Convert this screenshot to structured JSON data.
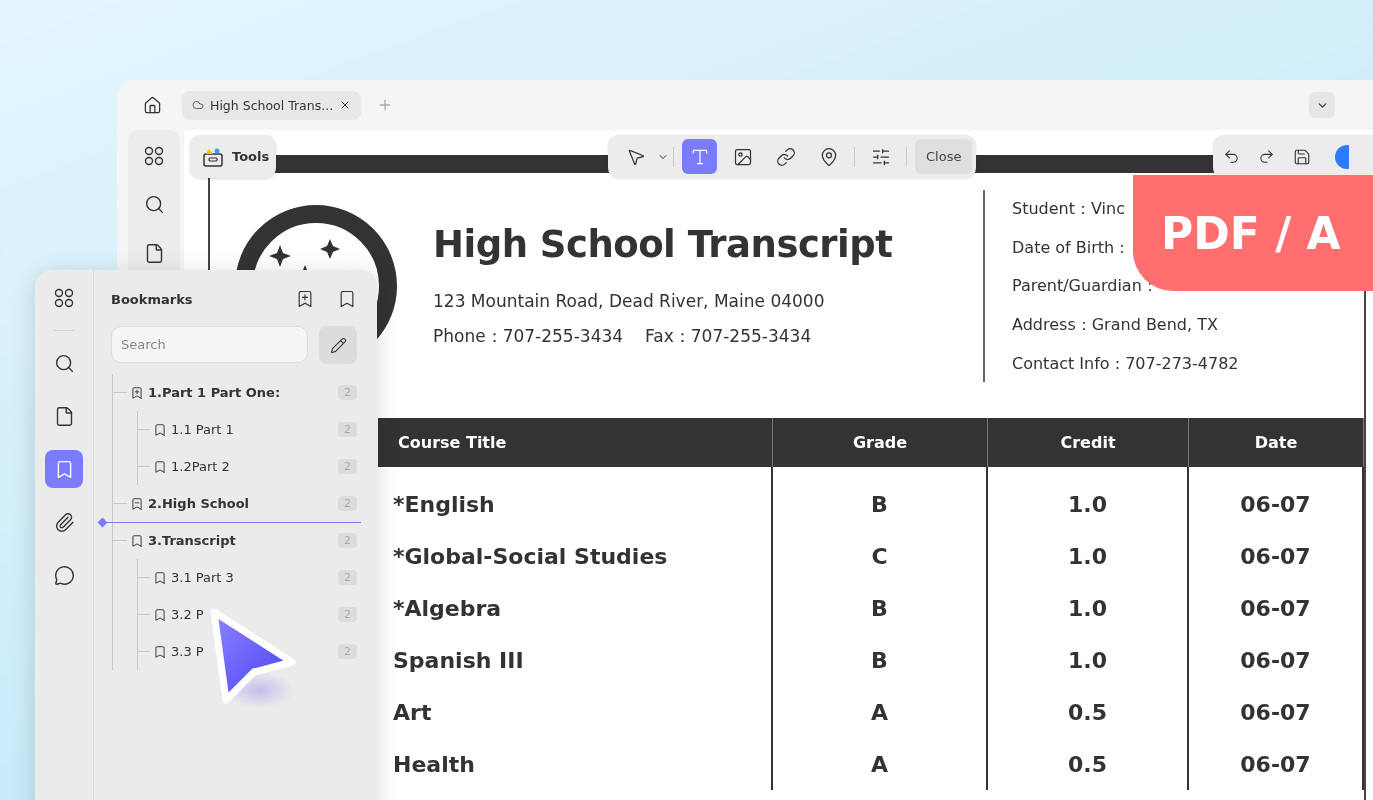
{
  "tab_bar": {
    "tabs": [
      {
        "label": "High School Trans...",
        "selected": true
      }
    ]
  },
  "tools_button": {
    "label": "Tools"
  },
  "edit_toolbar": {
    "tools": [
      {
        "kind": "select",
        "selected": false
      },
      {
        "kind": "text",
        "selected": true
      },
      {
        "kind": "image",
        "selected": false
      },
      {
        "kind": "link",
        "selected": false
      },
      {
        "kind": "location",
        "selected": false
      },
      {
        "kind": "settings",
        "selected": false
      }
    ],
    "close": "Close"
  },
  "document": {
    "title": "High School Transcript",
    "address": "123 Mountain Road, Dead River, Maine 04000",
    "phone": "Phone：707-255-3434",
    "fax": "Fax：707-255-3434",
    "info": [
      "Student：Vinc",
      "Date of Birth：",
      "Parent/Guardian：",
      "Address：Grand Bend, TX",
      "Contact Info : 707-273-4782"
    ],
    "table": {
      "columns": [
        "Course Title",
        "Grade",
        "Credit",
        "Date"
      ],
      "rows": [
        [
          "*English",
          "B",
          "1.0",
          "06-07"
        ],
        [
          "*Global-Social Studies",
          "C",
          "1.0",
          "06-07"
        ],
        [
          "*Algebra",
          "B",
          "1.0",
          "06-07"
        ],
        [
          "Spanish III",
          "B",
          "1.0",
          "06-07"
        ],
        [
          "Art",
          "A",
          "0.5",
          "06-07"
        ],
        [
          "Health",
          "A",
          "0.5",
          "06-07"
        ]
      ]
    }
  },
  "badge": "PDF / A",
  "bookmarks": {
    "rail": [
      {
        "kind": "grid",
        "selected": false
      },
      {
        "kind": "search",
        "selected": false
      },
      {
        "kind": "page",
        "selected": false
      },
      {
        "kind": "bookmark",
        "selected": true
      },
      {
        "kind": "attachment",
        "selected": false
      },
      {
        "kind": "comment",
        "selected": false
      }
    ],
    "title": "Bookmarks",
    "search": {
      "placeholder": "Search"
    },
    "items": [
      {
        "label": "1.Part 1 Part One:",
        "count": "2",
        "kind": "plus",
        "drop_indicator": false,
        "children": [
          {
            "label": "1.1 Part 1",
            "count": "2",
            "kind": "plain",
            "drop_indicator": false
          },
          {
            "label": "1.2Part 2",
            "count": "2",
            "kind": "plain",
            "drop_indicator": false
          }
        ]
      },
      {
        "label": "2.High School",
        "count": "2",
        "kind": "minus",
        "drop_indicator": true
      },
      {
        "label": "3.Transcript",
        "count": "2",
        "kind": "plain",
        "drop_indicator": false,
        "children": [
          {
            "label": "3.1 Part 3",
            "count": "2",
            "kind": "plain",
            "drop_indicator": false
          },
          {
            "label": "3.2 P",
            "count": "2",
            "kind": "plain",
            "drop_indicator": false
          },
          {
            "label": "3.3 P",
            "count": "2",
            "kind": "plain",
            "drop_indicator": false
          }
        ]
      }
    ]
  }
}
